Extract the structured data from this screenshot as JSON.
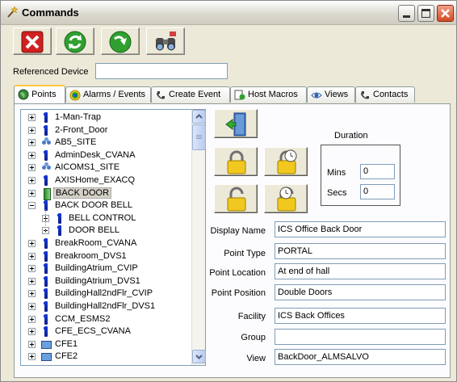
{
  "window": {
    "title": "Commands",
    "controls": [
      "minimize",
      "maximize",
      "close"
    ]
  },
  "toolbar": {
    "buttons": [
      {
        "name": "cancel",
        "icon": "red-x-icon"
      },
      {
        "name": "refresh",
        "icon": "green-refresh-icon"
      },
      {
        "name": "apply",
        "icon": "green-arrow-icon"
      },
      {
        "name": "search",
        "icon": "binoculars-icon"
      }
    ]
  },
  "referenced_device": {
    "label": "Referenced Device",
    "value": ""
  },
  "tabs": [
    {
      "label": "Points",
      "icon": "globe-icon",
      "active": true
    },
    {
      "label": "Alarms / Events",
      "icon": "target-icon",
      "active": false
    },
    {
      "label": "Create Event",
      "icon": "phone-icon",
      "active": false
    },
    {
      "label": "Host Macros",
      "icon": "macro-icon",
      "active": false
    },
    {
      "label": "Views",
      "icon": "eye-icon",
      "active": false
    },
    {
      "label": "Contacts",
      "icon": "phone-icon",
      "active": false
    }
  ],
  "tree": {
    "items": [
      {
        "label": "1-Man-Trap",
        "icon": "bar",
        "level": 0,
        "expander": "plus"
      },
      {
        "label": "2-Front_Door",
        "icon": "bar",
        "level": 0,
        "expander": "plus"
      },
      {
        "label": "AB5_SITE",
        "icon": "site",
        "level": 0,
        "expander": "plus"
      },
      {
        "label": "AdminDesk_CVANA",
        "icon": "bar",
        "level": 0,
        "expander": "plus"
      },
      {
        "label": "AICOMS1_SITE",
        "icon": "site",
        "level": 0,
        "expander": "plus"
      },
      {
        "label": "AXISHome_EXACQ",
        "icon": "bar",
        "level": 0,
        "expander": "plus"
      },
      {
        "label": "BACK DOOR",
        "icon": "door",
        "level": 0,
        "expander": "plus",
        "selected": true
      },
      {
        "label": "BACK DOOR BELL",
        "icon": "bar",
        "level": 0,
        "expander": "minus"
      },
      {
        "label": "BELL CONTROL",
        "icon": "bar",
        "level": 1,
        "expander": "plus"
      },
      {
        "label": "DOOR BELL",
        "icon": "bar",
        "level": 1,
        "expander": "plus"
      },
      {
        "label": "BreakRoom_CVANA",
        "icon": "bar",
        "level": 0,
        "expander": "plus"
      },
      {
        "label": "Breakroom_DVS1",
        "icon": "bar",
        "level": 0,
        "expander": "plus"
      },
      {
        "label": "BuildingAtrium_CVIP",
        "icon": "bar",
        "level": 0,
        "expander": "plus"
      },
      {
        "label": "BuildingAtrium_DVS1",
        "icon": "bar",
        "level": 0,
        "expander": "plus"
      },
      {
        "label": "BuildingHall2ndFlr_CVIP",
        "icon": "bar",
        "level": 0,
        "expander": "plus"
      },
      {
        "label": "BuildingHall2ndFlr_DVS1",
        "icon": "bar",
        "level": 0,
        "expander": "plus"
      },
      {
        "label": "CCM_ESMS2",
        "icon": "bar",
        "level": 0,
        "expander": "plus"
      },
      {
        "label": "CFE_ECS_CVANA",
        "icon": "bar",
        "level": 0,
        "expander": "plus"
      },
      {
        "label": "CFE1",
        "icon": "pc",
        "level": 0,
        "expander": "plus"
      },
      {
        "label": "CFE2",
        "icon": "pc",
        "level": 0,
        "expander": "plus"
      }
    ]
  },
  "commands": [
    {
      "name": "exit-door",
      "icon": "door-exit-icon"
    },
    {
      "name": "lock",
      "icon": "padlock-locked-icon"
    },
    {
      "name": "timed-lock",
      "icon": "padlock-clock-locked-icon"
    },
    {
      "name": "unlock",
      "icon": "padlock-unlocked-icon"
    },
    {
      "name": "timed-unlock",
      "icon": "padlock-clock-unlocked-icon"
    }
  ],
  "duration": {
    "label": "Duration",
    "mins_label": "Mins",
    "mins_value": "0",
    "secs_label": "Secs",
    "secs_value": "0"
  },
  "fields": [
    {
      "label": "Display Name",
      "value": "ICS Office Back Door"
    },
    {
      "label": "Point Type",
      "value": "PORTAL"
    },
    {
      "label": "Point Location",
      "value": "At end of hall"
    },
    {
      "label": "Point Position",
      "value": "Double Doors"
    },
    {
      "label": "Facility",
      "value": "ICS Back Offices"
    },
    {
      "label": "Group",
      "value": ""
    },
    {
      "label": "View",
      "value": "BackDoor_ALMSALVO"
    }
  ]
}
